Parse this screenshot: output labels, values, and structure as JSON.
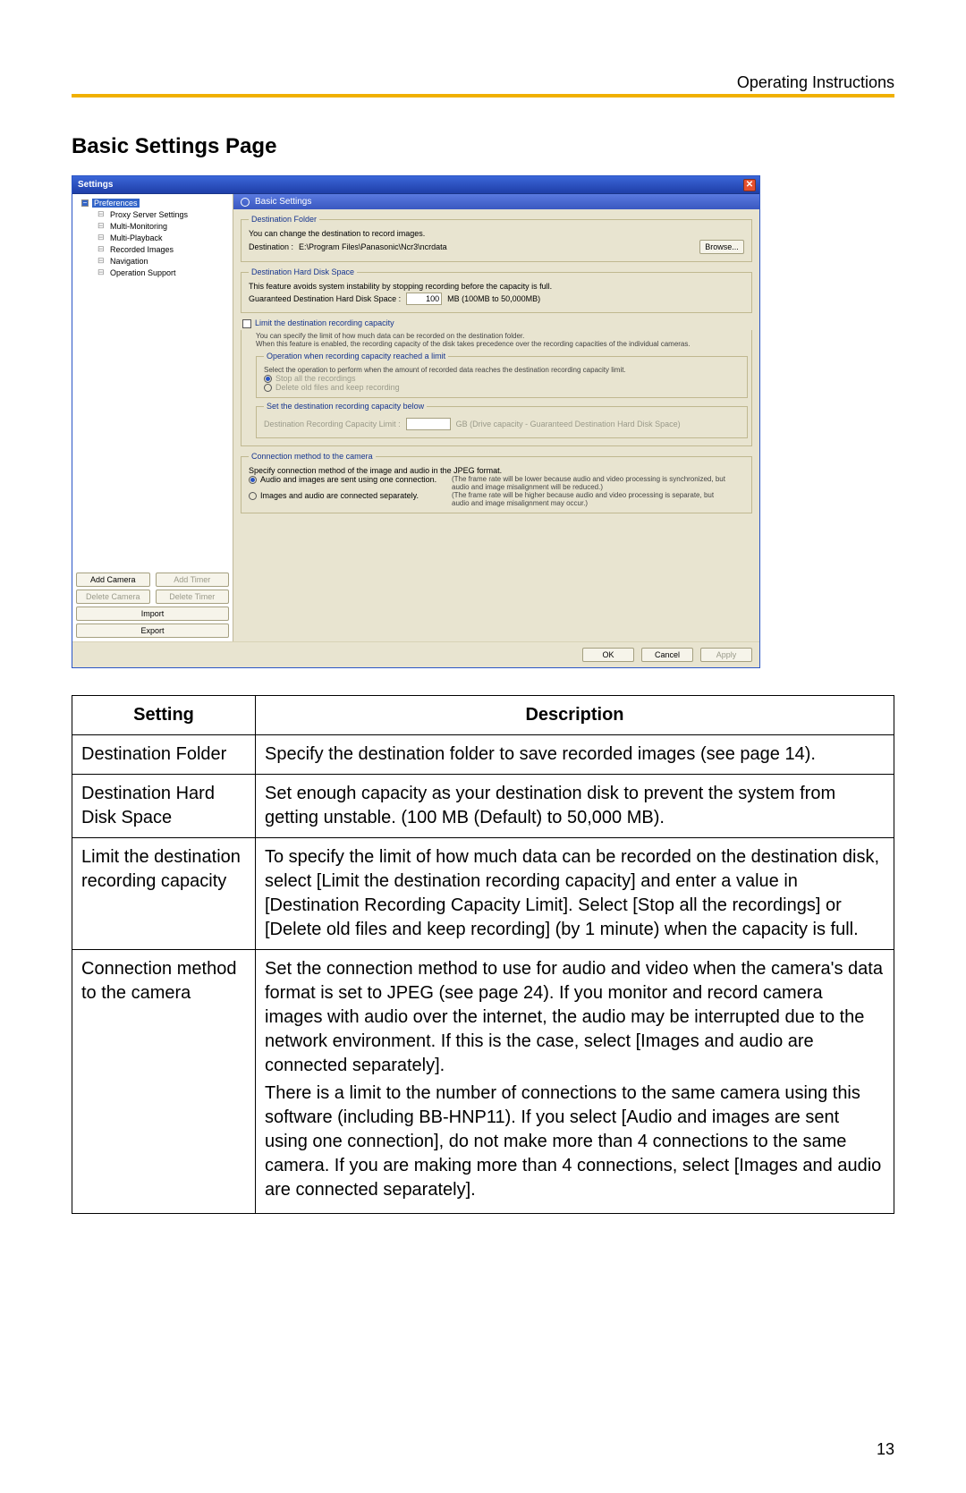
{
  "header": {
    "right": "Operating Instructions"
  },
  "section_title": "Basic Settings Page",
  "dialog": {
    "title": "Settings",
    "close_glyph": "✕",
    "tree": {
      "root": "Preferences",
      "children": [
        "Proxy Server Settings",
        "Multi-Monitoring",
        "Multi-Playback",
        "Recorded Images",
        "Navigation",
        "Operation Support"
      ]
    },
    "side_buttons": {
      "add_camera": "Add Camera",
      "add_timer": "Add Timer",
      "delete_camera": "Delete Camera",
      "delete_timer": "Delete Timer",
      "import": "Import",
      "export": "Export"
    },
    "panel_title": "Basic Settings",
    "dest_folder": {
      "legend": "Destination Folder",
      "desc": "You can change the destination to record images.",
      "label": "Destination :",
      "path": "E:\\Program Files\\Panasonic\\Ncr3\\ncrdata",
      "browse": "Browse..."
    },
    "disk_space": {
      "legend": "Destination Hard Disk Space",
      "desc": "This feature avoids system instability by stopping recording before the capacity is full.",
      "label": "Guaranteed Destination Hard Disk Space :",
      "value": "100",
      "range": "MB  (100MB to 50,000MB)"
    },
    "limit": {
      "checkbox_label": "Limit the destination recording capacity",
      "desc": "You can specify the limit of how much data can be recorded on the destination folder.\nWhen this feature is enabled, the recording capacity of the disk takes precedence over the recording capacities of the individual cameras.",
      "op_legend": "Operation when recording capacity reached a limit",
      "op_desc": "Select the operation to perform when the amount of recorded data reaches the destination recording capacity limit.",
      "op_stop": "Stop all the recordings",
      "op_delete": "Delete old files and keep recording",
      "set_legend": "Set the destination recording capacity below",
      "set_label": "Destination Recording Capacity Limit :",
      "set_unit": "GB  (Drive capacity - Guaranteed Destination Hard Disk Space)"
    },
    "conn": {
      "legend": "Connection method to the camera",
      "desc": "Specify connection method of the image and audio in the JPEG format.",
      "opt1": "Audio and images are sent using one connection.",
      "opt1_note": "(The frame rate will be lower because audio and video processing is synchronized, but audio and image misalignment will be reduced.)",
      "opt2": "Images and audio are connected separately.",
      "opt2_note": "(The frame rate will be higher because audio and video processing is separate, but audio and image misalignment may occur.)"
    },
    "footer": {
      "ok": "OK",
      "cancel": "Cancel",
      "apply": "Apply"
    }
  },
  "table": {
    "headers": {
      "setting": "Setting",
      "description": "Description"
    },
    "rows": [
      {
        "setting": "Destination Folder",
        "description": "Specify the destination folder to save recorded images (see page 14)."
      },
      {
        "setting": "Destination Hard Disk Space",
        "description": "Set enough capacity as your destination disk to prevent the system from getting unstable. (100 MB (Default) to 50,000 MB)."
      },
      {
        "setting": "Limit the destination recording capacity",
        "description": "To specify the limit of how much data can be recorded on the destination disk, select [Limit the destination recording capacity] and enter a value in [Destination Recording Capacity Limit]. Select [Stop all the recordings] or [Delete old files and keep recording] (by 1 minute) when the capacity is full."
      },
      {
        "setting": "Connection method to the camera",
        "description_p1": "Set the connection method to use for audio and video when the camera's data format is set to JPEG (see page 24). If you monitor and record camera images with audio over the internet, the audio may be interrupted due to the network environment. If this is the case, select [Images and audio are connected separately].",
        "description_p2": "There is a limit to the number of connections to the same camera using this software (including BB-HNP11). If you select [Audio and images are sent using one connection], do not make more than 4 connections to the same camera. If you are making more than 4 connections, select [Images and audio are connected separately]."
      }
    ]
  },
  "page_number": "13"
}
